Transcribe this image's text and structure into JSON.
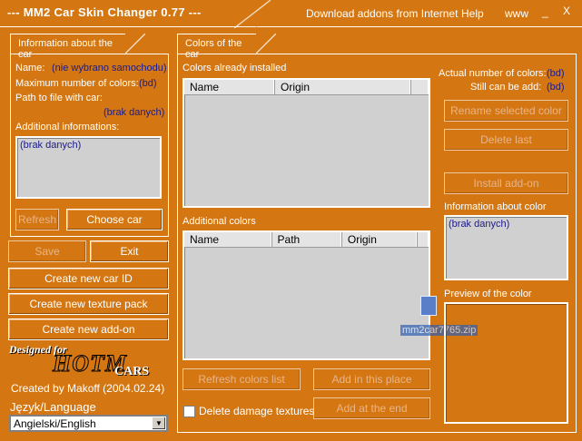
{
  "app": {
    "title": "--- MM2 Car Skin Changer 0.77 ---",
    "menu": [
      "Download addons from Internet",
      "Help",
      "www",
      "_",
      "X"
    ]
  },
  "car_info": {
    "tab": "Information about the car",
    "name_label": "Name:",
    "name_value": "(nie wybrano samochodu)",
    "max_colors_label": "Maximum number of colors:",
    "max_colors_value": "(bd)",
    "path_label": "Path to file with car:",
    "path_value": "(brak danych)",
    "additional_label": "Additional informations:",
    "additional_value": "(brak danych)",
    "refresh": "Refresh",
    "choose_car": "Choose car"
  },
  "actions": {
    "save": "Save",
    "exit": "Exit",
    "new_car_id": "Create new car ID",
    "new_texture_pack": "Create new texture pack",
    "new_addon": "Create new add-on"
  },
  "footer": {
    "designed_for": "Designed for",
    "logo": "HOTM",
    "logo_sub": "CARS",
    "created_by": "Created by Makoff (2004.02.24)",
    "language_label": "Język/Language",
    "language_value": "Angielski/English"
  },
  "colors": {
    "tab": "Colors of the car",
    "installed_label": "Colors already installed",
    "installed_columns": [
      "Name",
      "Origin"
    ],
    "additional_label": "Additional colors",
    "additional_columns": [
      "Name",
      "Path",
      "Origin"
    ],
    "actual_count_label": "Actual number of colors:",
    "actual_count_value": "(bd)",
    "can_add_label": "Still can be add:",
    "can_add_value": "(bd)",
    "rename": "Rename selected color",
    "delete_last": "Delete last",
    "install_addon": "Install add-on",
    "info_label": "Information about color",
    "info_value": "(brak danych)",
    "preview_label": "Preview of the color",
    "refresh_list": "Refresh colors list",
    "add_here": "Add in this place",
    "add_end": "Add at the end",
    "delete_damage": "Delete damage textures",
    "drag_file": "mm2car7765.zip"
  }
}
